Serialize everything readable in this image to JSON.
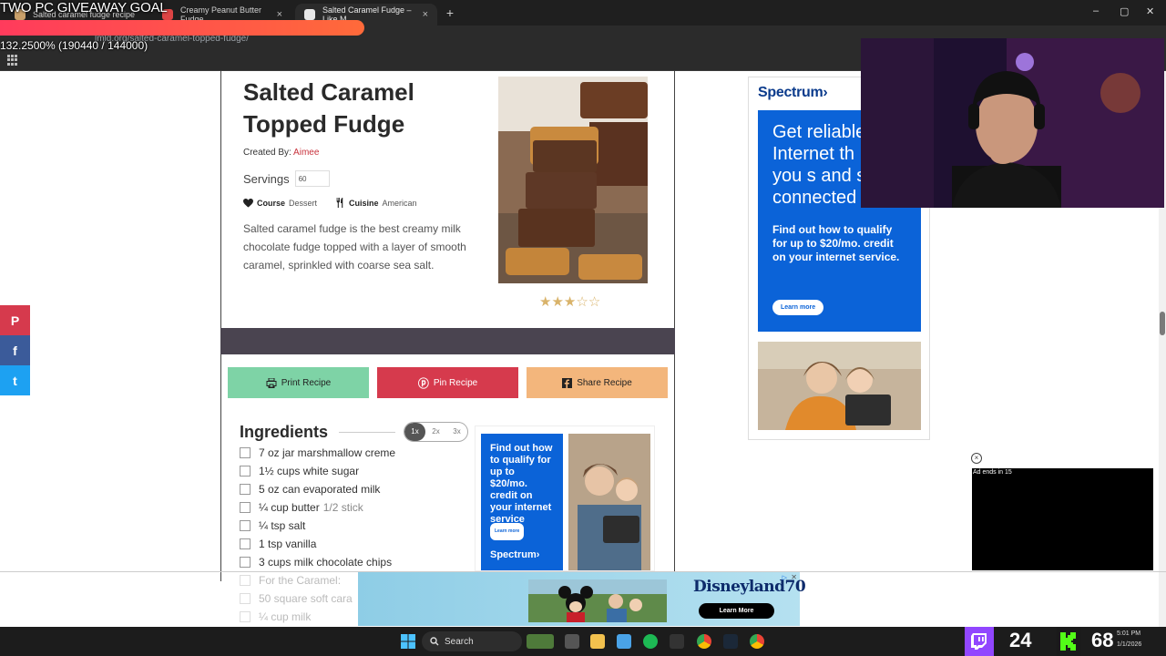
{
  "overlay": {
    "goal_text": "TWO PC GIVEAWAY GOAL",
    "goal_percent": "132.2500% (190440 / 144000)",
    "goal_progress": 1.0
  },
  "browser": {
    "tabs": [
      {
        "title": "Salted caramel fudge recipe",
        "active": false
      },
      {
        "title": "Creamy Peanut Butter Fudge",
        "active": false
      },
      {
        "title": "Salted Caramel Fudge – Like M",
        "active": true
      }
    ],
    "url": "lmld.org/salted-caramel-topped-fudge/",
    "new_tab_label": "+",
    "window_controls": {
      "minimize": "–",
      "maximize": "▢",
      "close": "✕"
    }
  },
  "recipe": {
    "title": "Salted Caramel Topped Fudge",
    "created_by_label": "Created By:",
    "author": "Aimee",
    "servings_label": "Servings",
    "servings_value": "60",
    "course_label": "Course",
    "course_value": "Dessert",
    "cuisine_label": "Cuisine",
    "cuisine_value": "American",
    "description": "Salted caramel fudge is the best creamy milk chocolate fudge topped with a layer of smooth caramel, sprinkled with coarse sea salt.",
    "rating": 3,
    "rating_max": 5,
    "buttons": {
      "print": "Print Recipe",
      "pin": "Pin Recipe",
      "share": "Share Recipe"
    },
    "ingredients_title": "Ingredients",
    "scale_options": [
      "1x",
      "2x",
      "3x"
    ],
    "scale_selected": "1x",
    "ingredients": [
      {
        "text": "7 oz jar marshmallow creme",
        "note": ""
      },
      {
        "text": "1½ cups white sugar",
        "note": ""
      },
      {
        "text": "5 oz can evaporated milk",
        "note": ""
      },
      {
        "text": "¼ cup butter",
        "note": "1/2 stick"
      },
      {
        "text": "¼ tsp salt",
        "note": ""
      },
      {
        "text": "1 tsp vanilla",
        "note": ""
      },
      {
        "text": "3 cups milk chocolate chips",
        "note": ""
      }
    ],
    "ingredients_faded": [
      {
        "text": "For the Caramel:"
      },
      {
        "text": "50 square soft cara"
      },
      {
        "text": "¼ cup milk"
      }
    ]
  },
  "inline_ad": {
    "headline": "Find out how to qualify for up to $20/mo. credit on your internet service",
    "button": "Learn more",
    "brand": "Spectrum›"
  },
  "side_ad": {
    "brand": "Spectrum›",
    "headline": "Get reliable Internet th helps you s and stay connected",
    "sub": "Find out how to qualify for up to $20/mo. credit on your internet service.",
    "button": "Learn more"
  },
  "social": {
    "pinterest": "P",
    "facebook": "f",
    "twitter": "t"
  },
  "video_ad": {
    "label": "Ad ends in 15",
    "close": "×"
  },
  "bottom_ad": {
    "brand": "Disneyland",
    "brand_number": "70",
    "button": "Learn More",
    "info": "▷",
    "close": "✕"
  },
  "taskbar": {
    "search_label": "Search",
    "twitch_count": "24",
    "kick_count": "68",
    "time": "5:01 PM",
    "date": "1/1/2026"
  },
  "colors": {
    "pin_red": "#d63a4d",
    "print_green": "#7ed3a6",
    "share_orange": "#f3b67c",
    "spectrum_blue": "#0b63d8",
    "twitch_purple": "#9146ff",
    "kick_green": "#53fc18"
  }
}
